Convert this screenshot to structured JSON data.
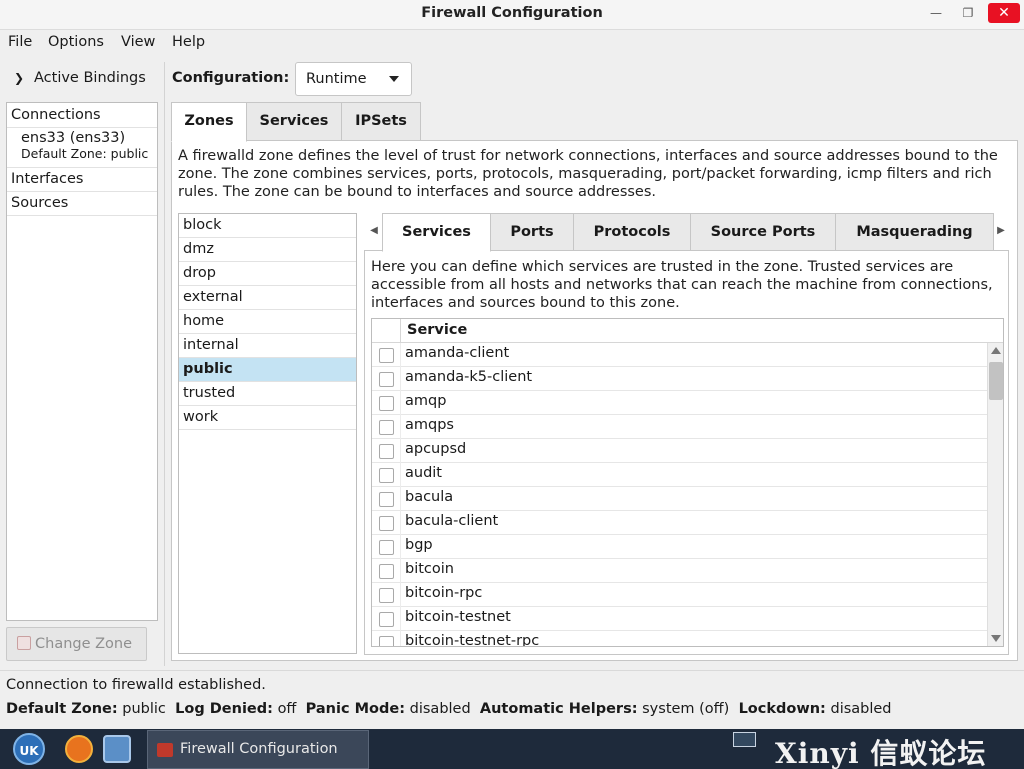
{
  "window": {
    "title": "Firewall Configuration"
  },
  "menu": [
    "File",
    "Options",
    "View",
    "Help"
  ],
  "bindings": {
    "header": "Active Bindings",
    "connections_label": "Connections",
    "connection_name": "ens33 (ens33)",
    "connection_zone": "Default Zone: public",
    "interfaces_label": "Interfaces",
    "sources_label": "Sources",
    "change_zone": "Change Zone"
  },
  "config": {
    "label": "Configuration:",
    "value": "Runtime"
  },
  "outer_tabs": [
    "Zones",
    "Services",
    "IPSets"
  ],
  "zone_desc": "A firewalld zone defines the level of trust for network connections, interfaces and source addresses bound to the zone. The zone combines services, ports, protocols, masquerading, port/packet forwarding, icmp filters and rich rules. The zone can be bound to interfaces and source addresses.",
  "zones": [
    "block",
    "dmz",
    "drop",
    "external",
    "home",
    "internal",
    "public",
    "trusted",
    "work"
  ],
  "selected_zone": "public",
  "inner_tabs": [
    "Services",
    "Ports",
    "Protocols",
    "Source Ports",
    "Masquerading"
  ],
  "svc_desc": "Here you can define which services are trusted in the zone. Trusted services are accessible from all hosts and networks that can reach the machine from connections, interfaces and sources bound to this zone.",
  "service_header": "Service",
  "services": [
    "amanda-client",
    "amanda-k5-client",
    "amqp",
    "amqps",
    "apcupsd",
    "audit",
    "bacula",
    "bacula-client",
    "bgp",
    "bitcoin",
    "bitcoin-rpc",
    "bitcoin-testnet",
    "bitcoin-testnet-rpc"
  ],
  "status": {
    "message": "Connection to firewalld established.",
    "default_zone_label": "Default Zone:",
    "default_zone": "public",
    "log_denied_label": "Log Denied:",
    "log_denied": "off",
    "panic_label": "Panic Mode:",
    "panic": "disabled",
    "helpers_label": "Automatic Helpers:",
    "helpers": "system (off)",
    "lockdown_label": "Lockdown:",
    "lockdown": "disabled"
  },
  "taskbar": {
    "start_label": "UK",
    "task_label": "Firewall Configuration",
    "watermark": "Xinyi 信蚁论坛"
  }
}
